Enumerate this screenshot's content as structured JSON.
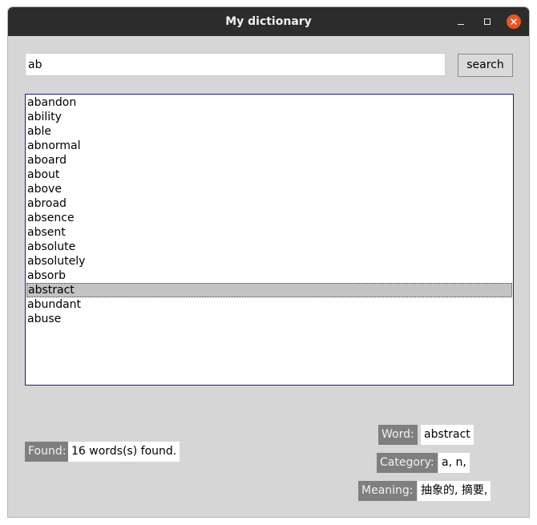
{
  "window": {
    "title": "My dictionary"
  },
  "search": {
    "value": "ab",
    "button_label": "search"
  },
  "words": [
    "abandon",
    "ability",
    "able",
    "abnormal",
    "aboard",
    "about",
    "above",
    "abroad",
    "absence",
    "absent",
    "absolute",
    "absolutely",
    "absorb",
    "abstract",
    "abundant",
    "abuse"
  ],
  "selected_index": 13,
  "found": {
    "label": "Found:",
    "value": "16 words(s) found."
  },
  "details": {
    "word_label": "Word:",
    "word_value": "abstract",
    "category_label": "Category:",
    "category_value": "a, n,",
    "meaning_label": "Meaning:",
    "meaning_value": "抽象的, 摘要,"
  },
  "colors": {
    "titlebar": "#2c2c2c",
    "close_button": "#e95420",
    "list_border": "#1c1c8c",
    "label_background": "#7f7f7f",
    "window_background": "#d6d6d6"
  }
}
